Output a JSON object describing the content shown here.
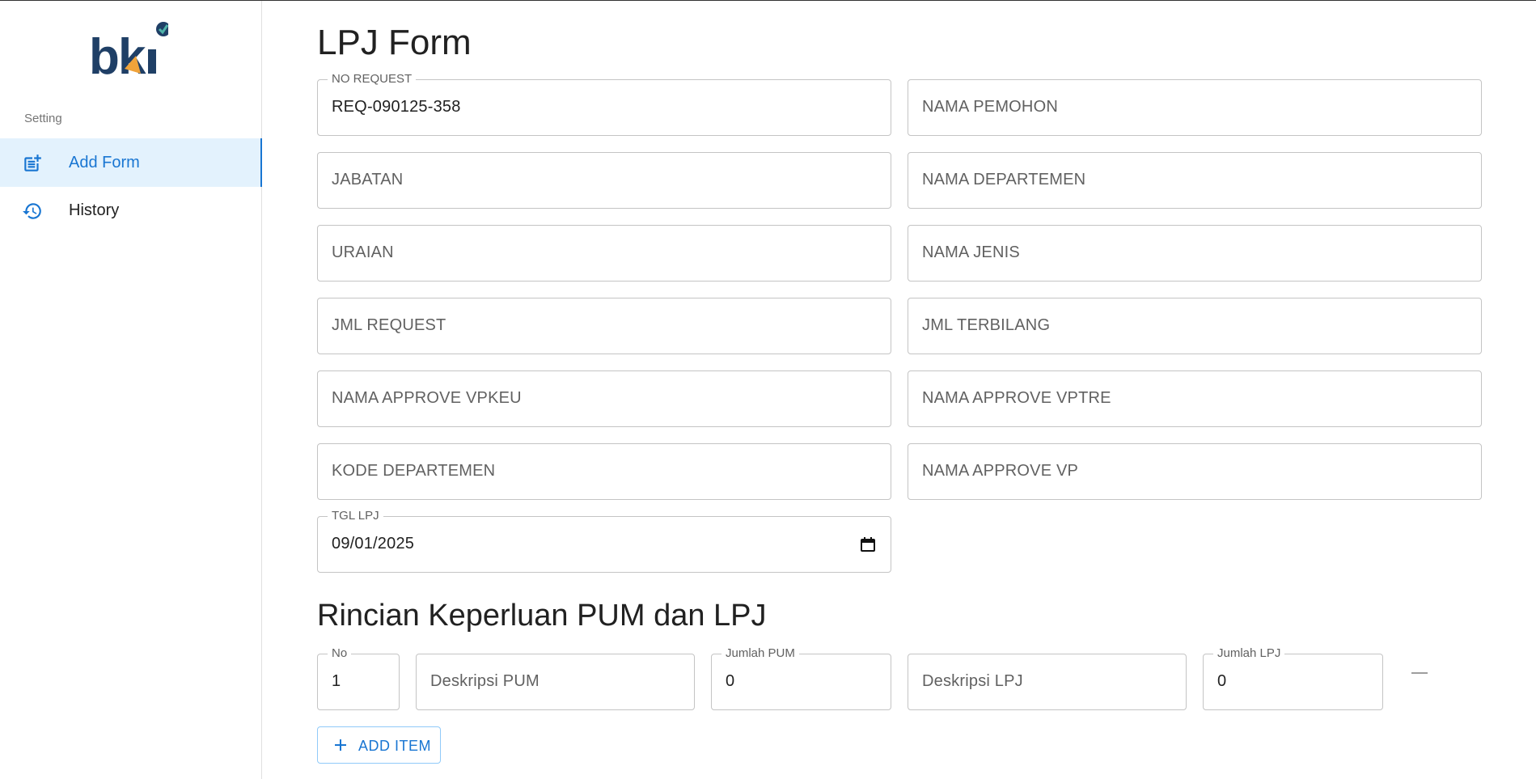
{
  "brand": {
    "logo_text": "bki",
    "accent": "#1976d2"
  },
  "sidebar": {
    "section_label": "Setting",
    "items": [
      {
        "label": "Add Form",
        "icon": "post-add-icon",
        "active": true
      },
      {
        "label": "History",
        "icon": "history-icon",
        "active": false
      }
    ]
  },
  "form": {
    "title": "LPJ Form",
    "fields": {
      "no_request": {
        "label": "NO REQUEST",
        "value": "REQ-090125-358"
      },
      "nama_pemohon": {
        "placeholder": "NAMA PEMOHON"
      },
      "jabatan": {
        "placeholder": "JABATAN"
      },
      "nama_departemen": {
        "placeholder": "NAMA DEPARTEMEN"
      },
      "uraian": {
        "placeholder": "URAIAN"
      },
      "nama_jenis": {
        "placeholder": "NAMA JENIS"
      },
      "jml_request": {
        "placeholder": "JML REQUEST"
      },
      "jml_terbilang": {
        "placeholder": "JML TERBILANG"
      },
      "nama_approve_vpkeu": {
        "placeholder": "NAMA APPROVE VPKEU"
      },
      "nama_approve_vptre": {
        "placeholder": "NAMA APPROVE VPTRE"
      },
      "kode_departemen": {
        "placeholder": "KODE DEPARTEMEN"
      },
      "nama_approve_vp": {
        "placeholder": "NAMA APPROVE VP"
      },
      "tgl_lpj": {
        "label": "TGL LPJ",
        "value": "09/01/2025"
      }
    }
  },
  "items_section": {
    "title": "Rincian Keperluan PUM dan LPJ",
    "row": {
      "no": {
        "label": "No",
        "value": "1"
      },
      "deskripsi_pum": {
        "placeholder": "Deskripsi PUM"
      },
      "jumlah_pum": {
        "label": "Jumlah PUM",
        "value": "0"
      },
      "deskripsi_lpj": {
        "placeholder": "Deskripsi LPJ"
      },
      "jumlah_lpj": {
        "label": "Jumlah LPJ",
        "value": "0"
      }
    },
    "add_button_label": "ADD ITEM"
  }
}
